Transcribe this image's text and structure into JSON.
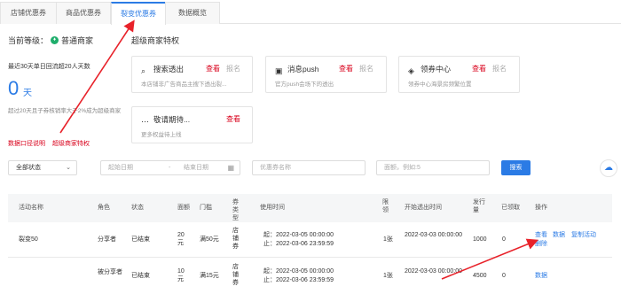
{
  "tabs": [
    "店铺优惠券",
    "商品优惠券",
    "裂变优惠券",
    "数据概览"
  ],
  "level": {
    "label": "当前等级：",
    "value": "普通商家"
  },
  "stats": {
    "line": "最近30天单日回流超20人天数",
    "value": "0",
    "unit": "天",
    "note": "超过20天且子券核销率大于2%成为超级商家"
  },
  "links": [
    "数据口径说明",
    "超级商家特权"
  ],
  "privileges": {
    "title": "超级商家特权",
    "cards": [
      {
        "icon": "search-icon",
        "name": "搜索透出",
        "view": "查看",
        "signup": "报名",
        "desc": "本店铺非广告商品主搜下透出裂..."
      },
      {
        "icon": "chat-icon",
        "name": "消息push",
        "view": "查看",
        "signup": "报名",
        "desc": "官方push会场下的透出"
      },
      {
        "icon": "ticket-icon",
        "name": "领券中心",
        "view": "查看",
        "signup": "报名",
        "desc": "领券中心海景房频繁位置"
      },
      {
        "icon": "ellipsis-icon",
        "name": "敬请期待...",
        "view": "查看",
        "signup": "",
        "desc": "更多权益待上线"
      }
    ]
  },
  "filters": {
    "status": "全部状态",
    "start_date": "起始日期",
    "sep": "-",
    "end_date": "结束日期",
    "coupon_name": "优惠券名称",
    "amount": "面额，例如:5",
    "search": "搜索"
  },
  "table": {
    "headers": [
      "活动名称",
      "角色",
      "状态",
      "面额",
      "门槛",
      "券类型",
      "使用时间",
      "限领",
      "开始透出时间",
      "发行量",
      "已领取",
      "操作"
    ],
    "rows": [
      {
        "name": "裂变50",
        "role": "分享者",
        "status": "已结束",
        "amount": "20元",
        "threshold": "满50元",
        "type": "店铺券",
        "time_start": "起：2022-03-05 00:00:00",
        "time_end": "止：2022-03-06 23:59:59",
        "limit": "1张",
        "start": "2022-03-03 00:00:00",
        "issued": "1000",
        "received": "0",
        "actions": [
          "查看",
          "数据",
          "复制活动",
          "删除"
        ]
      },
      {
        "name": "",
        "role": "被分享者",
        "status": "已结束",
        "amount": "10元",
        "threshold": "满15元",
        "type": "店铺券",
        "time_start": "起：2022-03-05 00:00:00",
        "time_end": "止：2022-03-06 23:59:59",
        "limit": "1张",
        "start": "2022-03-03 00:00:00",
        "issued": "4500",
        "received": "0",
        "actions": [
          "数据"
        ]
      }
    ]
  },
  "colors": {
    "accent": "#2b7be5",
    "danger": "#d9001b",
    "annotation_arrow": "#e8222a"
  }
}
